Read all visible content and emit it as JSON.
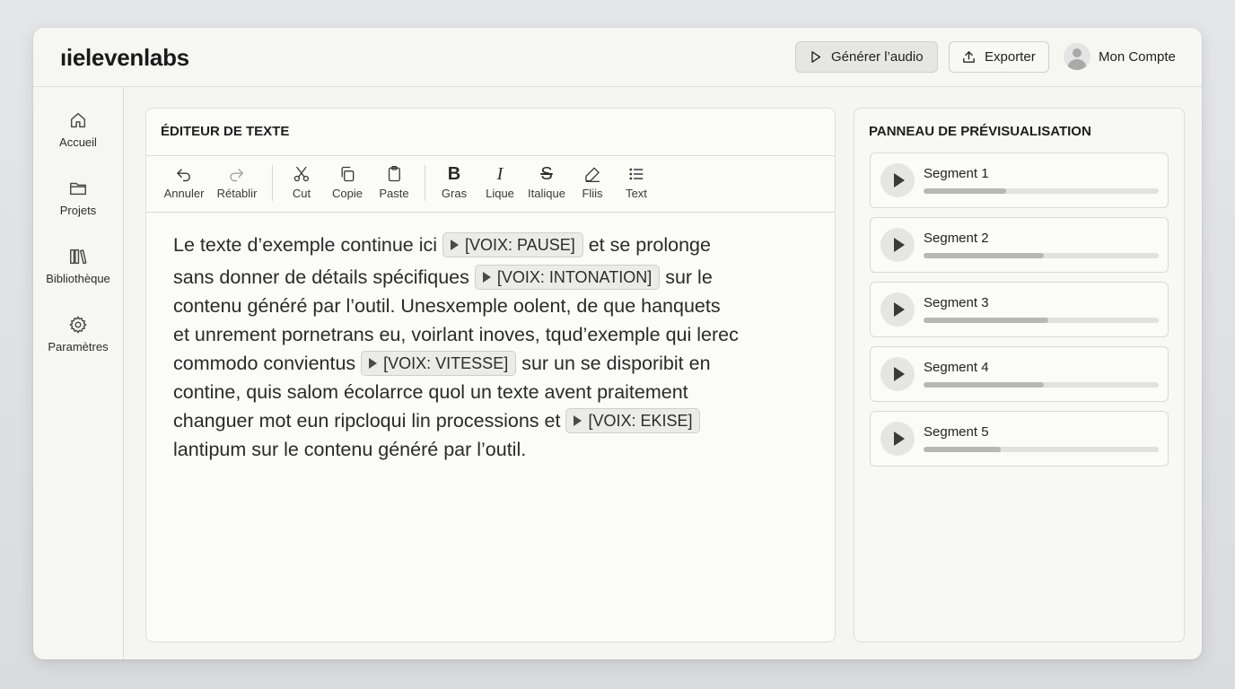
{
  "header": {
    "logo": "ıielevenlabs",
    "generate_label": "Générer l’audio",
    "export_label": "Exporter",
    "account_label": "Mon Compte"
  },
  "sidebar": {
    "items": [
      {
        "label": "Accueil",
        "icon": "home-icon"
      },
      {
        "label": "Projets",
        "icon": "folder-icon"
      },
      {
        "label": "Bibliothèque",
        "icon": "library-icon"
      },
      {
        "label": "Paramètres",
        "icon": "gear-icon"
      }
    ]
  },
  "editor": {
    "title": "ÉDITEUR DE TEXTE",
    "toolbar": [
      {
        "label": "Annuler",
        "icon": "undo-icon"
      },
      {
        "label": "Rétablir",
        "icon": "redo-icon"
      },
      {
        "label": "Cut",
        "icon": "scissors-icon"
      },
      {
        "label": "Copie",
        "icon": "copy-icon"
      },
      {
        "label": "Paste",
        "icon": "clipboard-icon"
      },
      {
        "label": "Gras",
        "icon": "bold-icon"
      },
      {
        "label": "Lique",
        "icon": "italic-icon"
      },
      {
        "label": "Italique",
        "icon": "strikethrough-icon"
      },
      {
        "label": "Fliis",
        "icon": "pen-icon"
      },
      {
        "label": "Text",
        "icon": "list-icon"
      }
    ],
    "lines": [
      {
        "a": "Le texte d’exemple continue ici",
        "tag": "[VOIX: PAUSE]",
        "b": "et se prolonge"
      },
      {
        "a": "sans donner de détails spécifiques",
        "tag": "[VOIX: INTONATION]",
        "b": "sur le"
      },
      {
        "a": "contenu généré par l’outil. Unesxemple oolent, de que hanquets"
      },
      {
        "a": "et unrement pornetrans eu, voirlant inoves, tqud’exemple qui lerec"
      },
      {
        "a": "commodo convientus",
        "tag": "[VOIX: VITESSE]",
        "b": "sur un se disporibit en"
      },
      {
        "a": "contine, quis salom écolarrce quol un texte avent praitement"
      },
      {
        "a": "changuer mot eun ripcloqui lin processions et",
        "tag": "[VOIX: EKISE]"
      },
      {
        "a": "lantipum sur le contenu généré par l’outil."
      }
    ]
  },
  "preview": {
    "title": "PANNEAU DE PRÉVISUALISATION",
    "segments": [
      {
        "label": "Segment 1",
        "progress": 0.35
      },
      {
        "label": "Segment 2",
        "progress": 0.51
      },
      {
        "label": "Segment 3",
        "progress": 0.53
      },
      {
        "label": "Segment 4",
        "progress": 0.51
      },
      {
        "label": "Segment 5",
        "progress": 0.33
      }
    ]
  }
}
